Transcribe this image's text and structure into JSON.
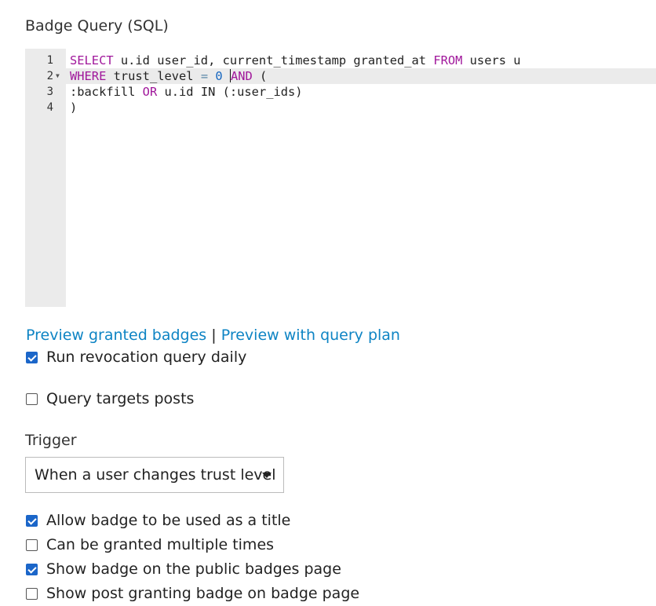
{
  "badge_query": {
    "label": "Badge Query (SQL)",
    "lines": [
      {
        "number": "1",
        "tokens": [
          {
            "text": "SELECT",
            "kind": "kw"
          },
          {
            "text": " u.id user_id, current_timestamp granted_at ",
            "kind": "plain"
          },
          {
            "text": "FROM",
            "kind": "kw"
          },
          {
            "text": " users u",
            "kind": "plain"
          }
        ]
      },
      {
        "number": "2",
        "active": true,
        "fold": true,
        "tokens": [
          {
            "text": "WHERE",
            "kind": "kw"
          },
          {
            "text": " trust_level ",
            "kind": "plain"
          },
          {
            "text": "=",
            "kind": "op"
          },
          {
            "text": " ",
            "kind": "plain"
          },
          {
            "text": "0",
            "kind": "num"
          },
          {
            "text": " ",
            "kind": "plain"
          },
          {
            "text": "",
            "kind": "cursor"
          },
          {
            "text": "AND",
            "kind": "kw"
          },
          {
            "text": " (",
            "kind": "plain"
          }
        ]
      },
      {
        "number": "3",
        "tokens": [
          {
            "text": ":backfill ",
            "kind": "plain"
          },
          {
            "text": "OR",
            "kind": "kw"
          },
          {
            "text": " u.id IN (:user_ids)",
            "kind": "plain"
          }
        ]
      },
      {
        "number": "4",
        "tokens": [
          {
            "text": ")",
            "kind": "plain"
          }
        ]
      }
    ]
  },
  "preview": {
    "granted_badges": "Preview granted badges",
    "separator": "|",
    "with_query_plan": "Preview with query plan"
  },
  "options": {
    "revocation": {
      "label": "Run revocation query daily",
      "checked": true
    },
    "targets_posts": {
      "label": "Query targets posts",
      "checked": false
    }
  },
  "trigger": {
    "label": "Trigger",
    "selected": "When a user changes trust level"
  },
  "badge_settings": [
    {
      "key": "allow_title",
      "label": "Allow badge to be used as a title",
      "checked": true
    },
    {
      "key": "multiple_grant",
      "label": "Can be granted multiple times",
      "checked": false
    },
    {
      "key": "listable",
      "label": "Show badge on the public badges page",
      "checked": true
    },
    {
      "key": "show_posts",
      "label": "Show post granting badge on badge page",
      "checked": false
    }
  ],
  "colors": {
    "link": "#0e84c4",
    "checkbox_checked": "#1b66c9",
    "sql_keyword": "#a0179b",
    "sql_number": "#1566c0",
    "gutter": "#ebebeb"
  },
  "icons": {
    "fold": "fold-arrow-icon",
    "select": "caret-down-icon",
    "checkbox_checked": "checkbox-checked-icon",
    "checkbox_unchecked": "checkbox-unchecked-icon"
  }
}
